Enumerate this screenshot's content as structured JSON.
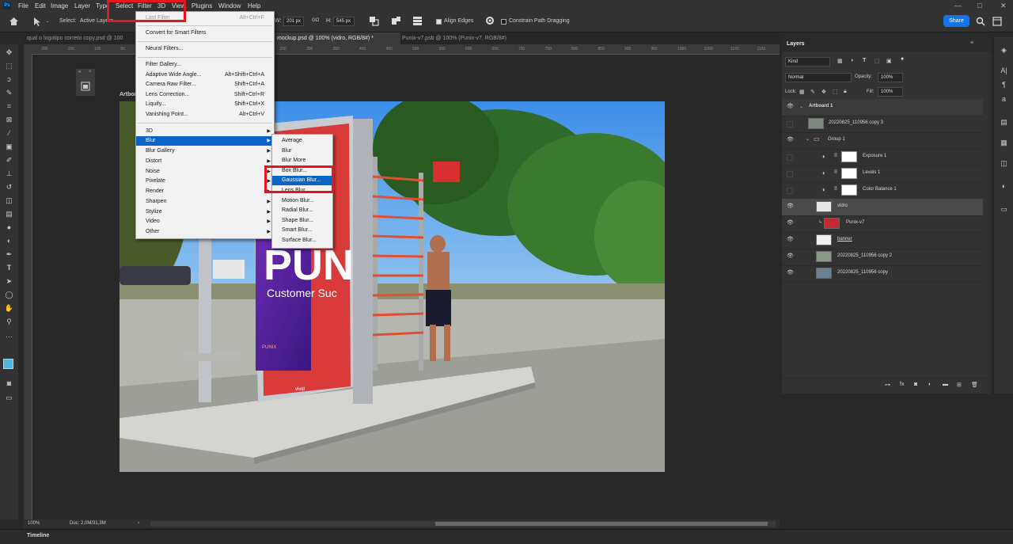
{
  "app": {
    "logo": "Ps",
    "menus": [
      "File",
      "Edit",
      "Image",
      "Layer",
      "Type",
      "Select",
      "Filter",
      "3D",
      "View",
      "Plugins",
      "Window",
      "Help"
    ],
    "window_controls": [
      "—",
      "□",
      "✕"
    ]
  },
  "options_bar": {
    "home_icon": "home-icon",
    "select_label": "Select:",
    "select_value": "Active Layers",
    "w_label": "W:",
    "w_value": "201 px",
    "link_label": "GO",
    "h_label": "H:",
    "h_value": "545 px",
    "align_edges_label": "Align Edges",
    "align_edges_checked": true,
    "constrain_label": "Constrain Path Dragging",
    "constrain_checked": false,
    "share_label": "Share"
  },
  "tabs": [
    {
      "label": "qual o logotipo correto copy.psd @ 100",
      "active": false
    },
    {
      "label": "mockup.psd @ 100% (vidro, RGB/8#) *",
      "active": true
    },
    {
      "label": "Punix-v7.psb @ 100% (Punix-v7, RGB/8#)",
      "active": false
    }
  ],
  "ruler_ticks": [
    "200",
    "150",
    "100",
    "50",
    "0",
    "50",
    "100",
    "150",
    "200",
    "250",
    "300",
    "350",
    "400",
    "450",
    "500",
    "550",
    "600",
    "650",
    "700",
    "750",
    "800",
    "850",
    "900",
    "950",
    "1000",
    "1050",
    "1100",
    "1150",
    "1200"
  ],
  "canvas": {
    "artboard_label": "Artboard 1",
    "poster_text_big": "PUN",
    "poster_text_sub": "Customer Suc",
    "poster_brand": "PUNIX",
    "sign_brand": "vivid"
  },
  "filter_menu": {
    "items": [
      {
        "label": "Last Filter",
        "shortcut": "Alt+Ctrl+F",
        "disabled": true
      },
      {
        "sep": true
      },
      {
        "label": "Convert for Smart Filters",
        "shortcut": ""
      },
      {
        "sep": true
      },
      {
        "label": "Neural Filters...",
        "shortcut": ""
      },
      {
        "sep": true
      },
      {
        "label": "Filter Gallery...",
        "shortcut": ""
      },
      {
        "label": "Adaptive Wide Angle...",
        "shortcut": "Alt+Shift+Ctrl+A"
      },
      {
        "label": "Camera Raw Filter...",
        "shortcut": "Shift+Ctrl+A"
      },
      {
        "label": "Lens Correction...",
        "shortcut": "Shift+Ctrl+R"
      },
      {
        "label": "Liquify...",
        "shortcut": "Shift+Ctrl+X"
      },
      {
        "label": "Vanishing Point...",
        "shortcut": "Alt+Ctrl+V"
      },
      {
        "sep": true
      },
      {
        "label": "3D",
        "submenu": true
      },
      {
        "label": "Blur",
        "submenu": true,
        "highlighted": true
      },
      {
        "label": "Blur Gallery",
        "submenu": true
      },
      {
        "label": "Distort",
        "submenu": true
      },
      {
        "label": "Noise",
        "submenu": true
      },
      {
        "label": "Pixelate",
        "submenu": true
      },
      {
        "label": "Render",
        "submenu": true
      },
      {
        "label": "Sharpen",
        "submenu": true
      },
      {
        "label": "Stylize",
        "submenu": true
      },
      {
        "label": "Video",
        "submenu": true
      },
      {
        "label": "Other",
        "submenu": true
      }
    ]
  },
  "blur_submenu": {
    "items": [
      {
        "label": "Average"
      },
      {
        "label": "Blur"
      },
      {
        "label": "Blur More"
      },
      {
        "label": "Box Blur..."
      },
      {
        "label": "Gaussian Blur...",
        "highlighted": true
      },
      {
        "label": "Lens Blur..."
      },
      {
        "label": "Motion Blur..."
      },
      {
        "label": "Radial Blur..."
      },
      {
        "label": "Shape Blur..."
      },
      {
        "label": "Smart Blur..."
      },
      {
        "label": "Surface Blur..."
      }
    ]
  },
  "layers_panel": {
    "title": "Layers",
    "filter_kind": "Kind",
    "blend_mode": "Normal",
    "opacity_label": "Opacity:",
    "opacity_value": "100%",
    "lock_label": "Lock:",
    "fill_label": "Fill:",
    "fill_value": "100%",
    "layers": [
      {
        "name": "Artboard 1",
        "type": "artboard",
        "visible": true
      },
      {
        "name": "20220825_110956 copy 3",
        "type": "image",
        "visible": false
      },
      {
        "name": "Group 1",
        "type": "group",
        "visible": true
      },
      {
        "name": "Exposure 1",
        "type": "adjustment",
        "visible": false
      },
      {
        "name": "Levels 1",
        "type": "adjustment",
        "visible": false
      },
      {
        "name": "Color Balance 1",
        "type": "adjustment",
        "visible": false
      },
      {
        "name": "vidro",
        "type": "image",
        "visible": true,
        "selected": true
      },
      {
        "name": "Punix-v7",
        "type": "smart",
        "visible": true
      },
      {
        "name": "banner",
        "type": "image",
        "visible": true
      },
      {
        "name": "20220825_110956 copy 2",
        "type": "image",
        "visible": true
      },
      {
        "name": "20220825_110956 copy",
        "type": "image",
        "visible": true
      }
    ],
    "footer_icons": [
      "link-icon",
      "fx-icon",
      "mask-icon",
      "adjustment-icon",
      "folder-icon",
      "new-layer-icon",
      "trash-icon"
    ]
  },
  "status": {
    "zoom": "100%",
    "doc": "Doc: 2,0M/31,3M"
  },
  "timeline": {
    "label": "Timeline"
  },
  "colors": {
    "accent": "#1473e6",
    "highlight": "#0a64c8",
    "annotation_red": "#e8141e"
  }
}
